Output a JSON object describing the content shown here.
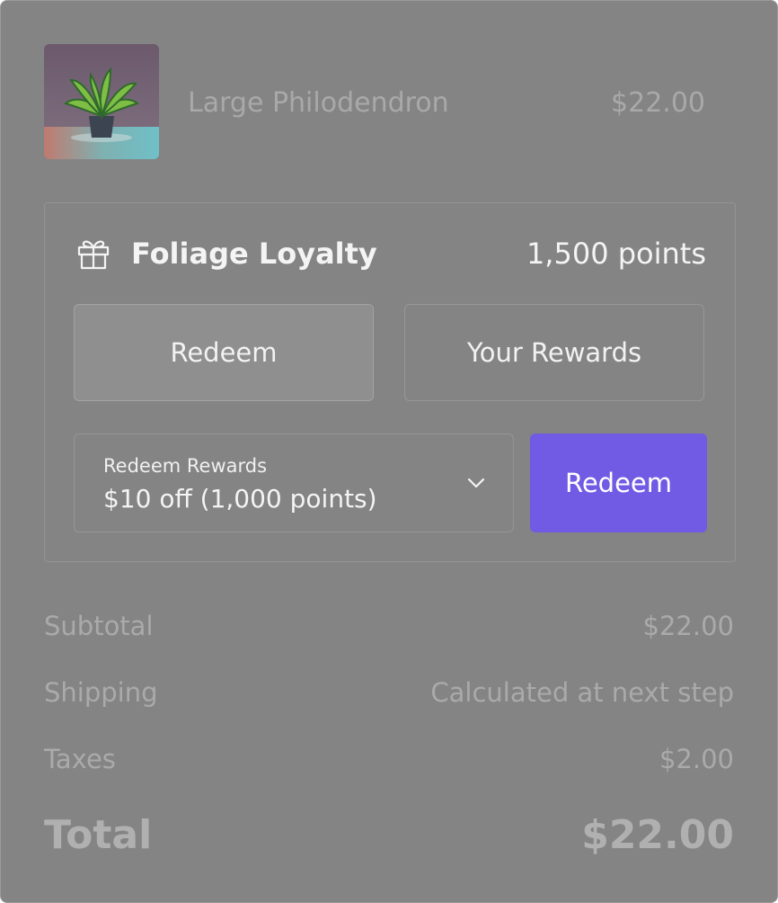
{
  "product": {
    "name": "Large Philodendron",
    "price": "$22.00",
    "image": "potted-plant-image"
  },
  "loyalty": {
    "icon": "gift-icon",
    "title": "Foliage Loyalty",
    "points": "1,500 points",
    "tabs": [
      {
        "label": "Redeem",
        "selected": true
      },
      {
        "label": "Your Rewards",
        "selected": false
      }
    ],
    "select": {
      "label": "Redeem Rewards",
      "value": "$10 off (1,000 points)",
      "icon": "chevron-down-icon"
    },
    "redeem_button": "Redeem",
    "accent_color": "#715ae4"
  },
  "summary": {
    "rows": [
      {
        "label": "Subtotal",
        "value": "$22.00"
      },
      {
        "label": "Shipping",
        "value": "Calculated at next step"
      },
      {
        "label": "Taxes",
        "value": "$2.00"
      }
    ],
    "total_label": "Total",
    "total_value": "$22.00"
  }
}
